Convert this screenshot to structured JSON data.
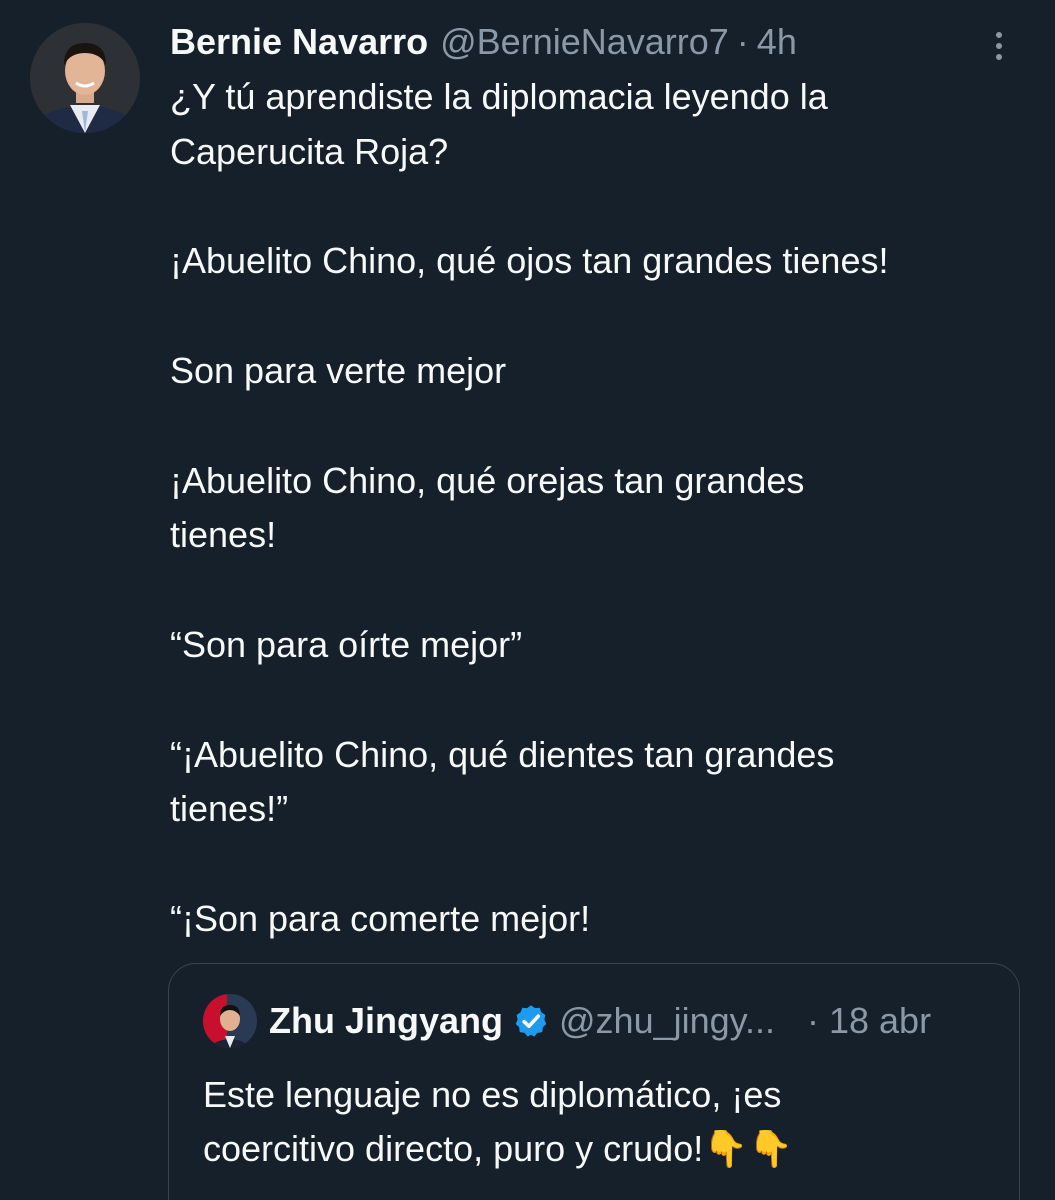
{
  "tweet": {
    "author_name": "Bernie Navarro",
    "handle": "@BernieNavarro7",
    "separator": "·",
    "time": "4h",
    "more_icon": "more-vertical-icon",
    "text": "¿Y tú aprendiste la diplomacia leyendo la\nCaperucita Roja?\n\n¡Abuelito Chino, qué ojos tan grandes tienes!\n\nSon para verte mejor\n\n¡Abuelito Chino, qué orejas tan grandes\ntienes!\n\n“Son para oírte mejor”\n\n“¡Abuelito Chino, qué dientes tan grandes\ntienes!”\n\n“¡Son para comerte mejor!"
  },
  "quoted_tweet": {
    "author_name": "Zhu Jingyang",
    "verified_icon": "verified-badge-icon",
    "handle": "@zhu_jingy...",
    "time": "· 18 abr",
    "text": "Este lenguaje no es diplomático, ¡es\ncoercitivo directo, puro y crudo!👇👇"
  },
  "colors": {
    "background": "#15202b",
    "text_primary": "#f7f9f9",
    "text_secondary": "#8b98a5",
    "border": "#38444d",
    "verified_blue": "#1d9bf0"
  }
}
